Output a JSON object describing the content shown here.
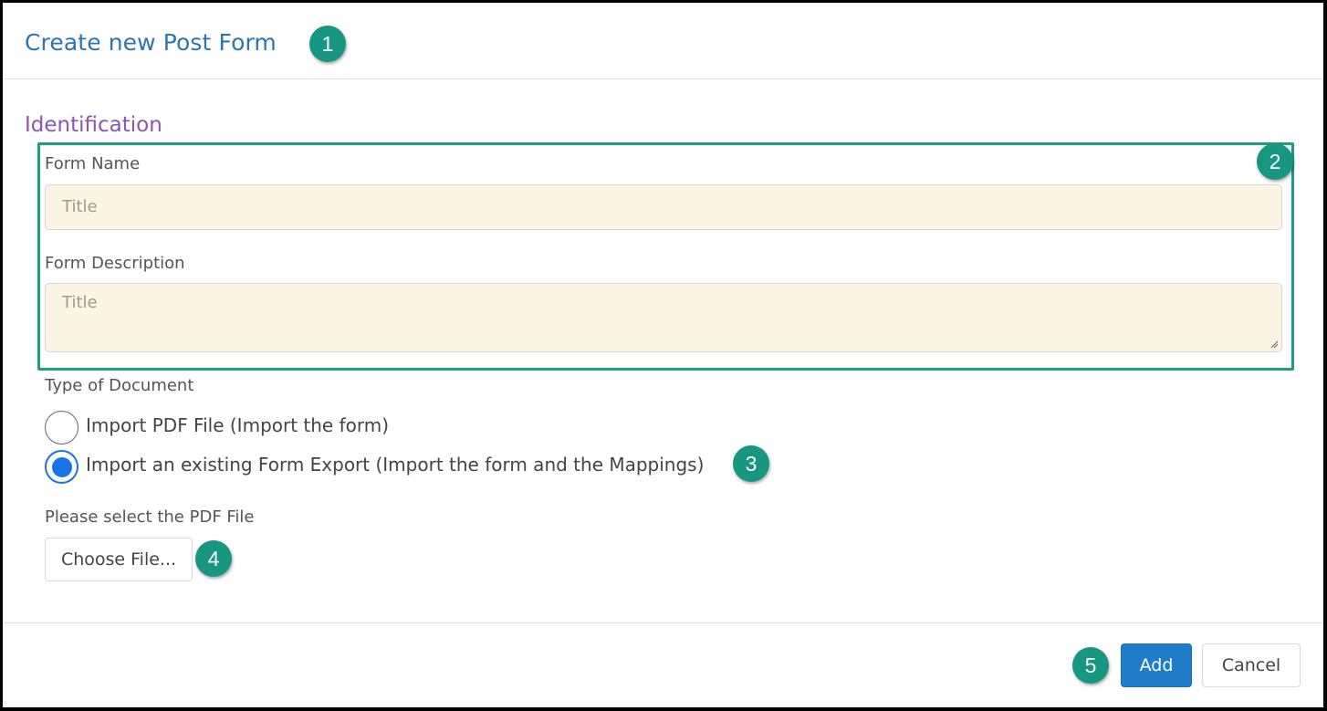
{
  "dialog": {
    "title": "Create new Post Form",
    "section_title": "Identification"
  },
  "form": {
    "name_label": "Form Name",
    "name_placeholder": "Title",
    "description_label": "Form Description",
    "description_placeholder": "Title",
    "type_label": "Type of Document",
    "options": [
      {
        "label": "Import PDF File (Import the form)",
        "checked": false
      },
      {
        "label": "Import an existing Form Export (Import the form and the Mappings)",
        "checked": true
      }
    ],
    "file_label": "Please select the PDF File",
    "file_button": "Choose File..."
  },
  "footer": {
    "add_label": "Add",
    "cancel_label": "Cancel"
  },
  "callouts": [
    "1",
    "2",
    "3",
    "4",
    "5"
  ],
  "colors": {
    "title": "#2b75b3",
    "section": "#8b55b5",
    "callout": "#179680",
    "input_bg": "#fdf5e3",
    "primary": "#1f7cc9"
  }
}
